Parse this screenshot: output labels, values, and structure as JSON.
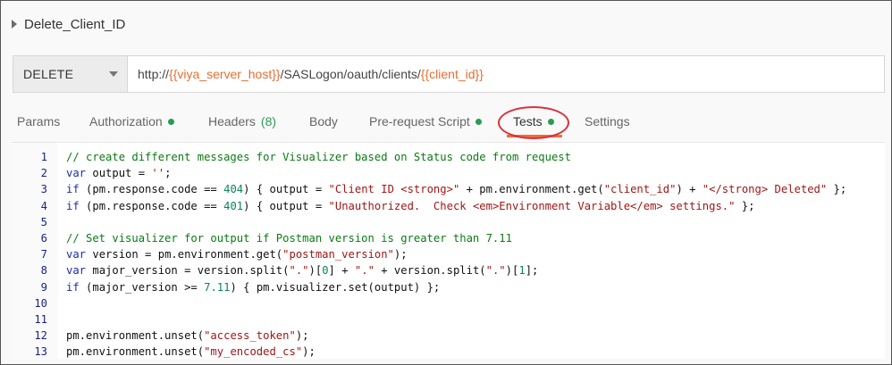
{
  "request": {
    "title": "Delete_Client_ID",
    "method": "DELETE",
    "url_parts": [
      "http://",
      "{{viya_server_host}}",
      "/SASLogon/oauth/clients/",
      "{{client_id}}"
    ]
  },
  "tabs": [
    {
      "label": "Params"
    },
    {
      "label": "Authorization"
    },
    {
      "label": "Headers",
      "count": "(8)"
    },
    {
      "label": "Body"
    },
    {
      "label": "Pre-request Script"
    },
    {
      "label": "Tests"
    },
    {
      "label": "Settings"
    }
  ],
  "active_tab": "Tests",
  "code": {
    "line_numbers": [
      "1",
      "2",
      "3",
      "4",
      "5",
      "6",
      "7",
      "8",
      "9",
      "10",
      "11",
      "12",
      "13"
    ],
    "lines": [
      "// create different messages for Visualizer based on Status code from request",
      "var output = '';",
      "if (pm.response.code == 404) { output = \"Client ID <strong>\" + pm.environment.get(\"client_id\") + \"</strong> Deleted\" };",
      "if (pm.response.code == 401) { output = \"Unauthorized.  Check <em>Environment Variable</em> settings.\" };",
      "",
      "// Set visualizer for output if Postman version is greater than 7.11",
      "var version = pm.environment.get(\"postman_version\");",
      "var major_version = version.split(\".\")[0] + \".\" + version.split(\".\")[1];",
      "if (major_version >= 7.11) { pm.visualizer.set(output) };",
      "",
      "",
      "pm.environment.unset(\"access_token\");",
      "pm.environment.unset(\"my_encoded_cs\");"
    ]
  },
  "colors": {
    "variable": "#e86d2f",
    "status_dot": "#2b9b54",
    "active_underline": "#f26b3a",
    "highlight_ring": "#d7333b",
    "comment": "#0a7b12",
    "keyword": "#1a2cb5",
    "string": "#a31515"
  },
  "icons": [
    "caret-right-icon",
    "chevron-down-icon",
    "status-dot-icon"
  ]
}
